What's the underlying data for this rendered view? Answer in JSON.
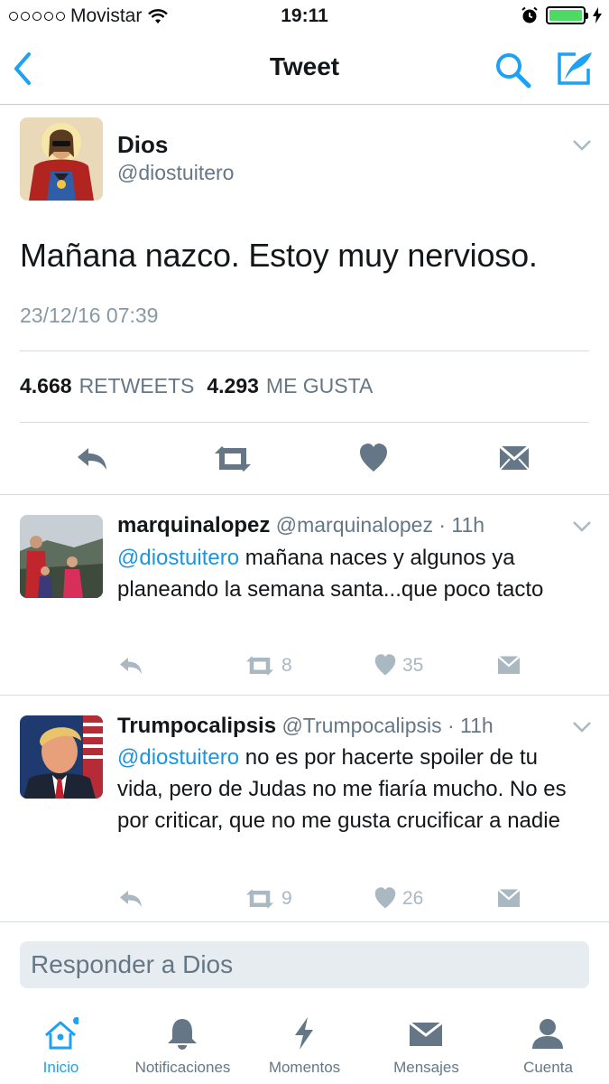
{
  "status_bar": {
    "carrier": "Movistar",
    "time": "19:11"
  },
  "nav": {
    "title": "Tweet",
    "icons": [
      "back-chevron-icon",
      "search-icon",
      "compose-icon"
    ]
  },
  "tweet": {
    "name": "Dios",
    "handle": "@diostuitero",
    "text": "Mañana nazco. Estoy muy nervioso.",
    "timestamp": "23/12/16 07:39",
    "retweets_count": "4.668",
    "retweets_label": "RETWEETS",
    "likes_count": "4.293",
    "likes_label": "ME GUSTA"
  },
  "replies": [
    {
      "name": "marquinalopez",
      "meta": "@marquinalopez · 11h",
      "mention": "@diostuitero",
      "text": " mañana naces y algunos ya planeando la semana santa...que poco tacto",
      "retweets": "8",
      "likes": "35"
    },
    {
      "name": "Trumpocalipsis",
      "meta": "@Trumpocalipsis · 11h",
      "mention": "@diostuitero",
      "text": " no es por hacerte spoiler de tu vida, pero de Judas no me fiaría mucho. No es por criticar, que no me gusta crucificar a nadie",
      "retweets": "9",
      "likes": "26"
    }
  ],
  "reply_box": {
    "placeholder": "Responder a Dios"
  },
  "tab_bar": {
    "tabs": [
      {
        "label": "Inicio",
        "icon": "home-icon",
        "active": true
      },
      {
        "label": "Notificaciones",
        "icon": "bell-icon",
        "active": false
      },
      {
        "label": "Momentos",
        "icon": "lightning-icon",
        "active": false
      },
      {
        "label": "Mensajes",
        "icon": "envelope-icon",
        "active": false
      },
      {
        "label": "Cuenta",
        "icon": "person-icon",
        "active": false
      }
    ]
  },
  "colors": {
    "accent": "#1da1f2",
    "mention": "#1b95e0",
    "muted_text": "#657786",
    "action_icon": "#aab8c2",
    "main_action_icon": "#657786",
    "battery": "#4cd964"
  }
}
